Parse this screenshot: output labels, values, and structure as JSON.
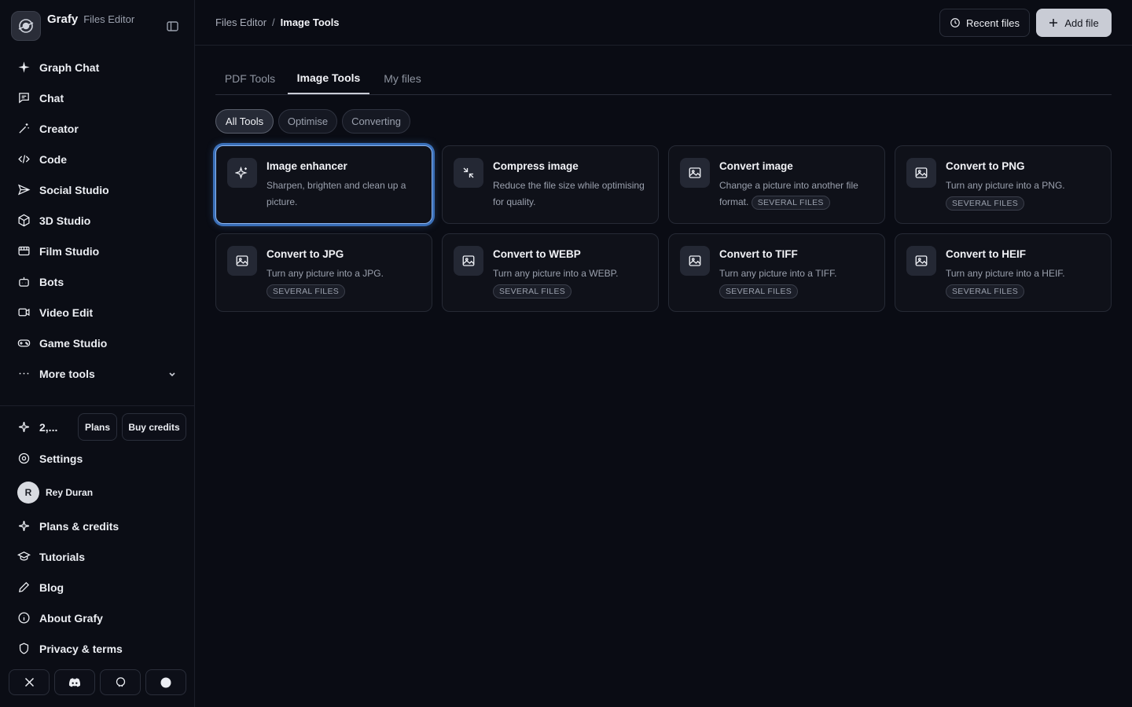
{
  "brand": {
    "name": "Grafy",
    "subtitle": "Files Editor"
  },
  "sidebar": {
    "items": [
      {
        "label": "Graph Chat",
        "icon": "sparkle-icon"
      },
      {
        "label": "Chat",
        "icon": "message-icon"
      },
      {
        "label": "Creator",
        "icon": "wand-icon"
      },
      {
        "label": "Code",
        "icon": "code-icon"
      },
      {
        "label": "Social Studio",
        "icon": "send-icon"
      },
      {
        "label": "3D Studio",
        "icon": "cube-icon"
      },
      {
        "label": "Film Studio",
        "icon": "film-icon"
      },
      {
        "label": "Bots",
        "icon": "bot-icon"
      },
      {
        "label": "Video Edit",
        "icon": "video-icon"
      },
      {
        "label": "Game Studio",
        "icon": "gamepad-icon"
      },
      {
        "label": "More tools",
        "icon": "more-icon"
      }
    ],
    "credits": {
      "value": "2,...",
      "plans_label": "Plans",
      "buy_label": "Buy credits"
    },
    "settings_label": "Settings",
    "user": {
      "initial": "R",
      "name": "Rey Duran"
    },
    "bottom_items": [
      {
        "label": "Plans & credits",
        "icon": "sparkle-outline-icon"
      },
      {
        "label": "Tutorials",
        "icon": "graduation-cap-icon"
      },
      {
        "label": "Blog",
        "icon": "pencil-icon"
      },
      {
        "label": "About Grafy",
        "icon": "info-icon"
      },
      {
        "label": "Privacy & terms",
        "icon": "shield-icon"
      }
    ]
  },
  "header": {
    "breadcrumb": [
      "Files Editor",
      "Image Tools"
    ],
    "recent_label": "Recent files",
    "add_label": "Add file"
  },
  "tabs": [
    "PDF Tools",
    "Image Tools",
    "My files"
  ],
  "filters": [
    "All Tools",
    "Optimise",
    "Converting"
  ],
  "badge_label": "SEVERAL FILES",
  "cards": [
    {
      "title": "Image enhancer",
      "desc": "Sharpen, brighten and clean up a picture."
    },
    {
      "title": "Compress image",
      "desc": "Reduce the file size while optimising for quality."
    },
    {
      "title": "Convert image",
      "desc": "Change a picture into another file format."
    },
    {
      "title": "Convert to PNG",
      "desc": "Turn any picture into a PNG."
    },
    {
      "title": "Convert to JPG",
      "desc": "Turn any picture into a JPG."
    },
    {
      "title": "Convert to WEBP",
      "desc": "Turn any picture into a WEBP."
    },
    {
      "title": "Convert to TIFF",
      "desc": "Turn any picture into a TIFF."
    },
    {
      "title": "Convert to HEIF",
      "desc": "Turn any picture into a HEIF."
    }
  ]
}
